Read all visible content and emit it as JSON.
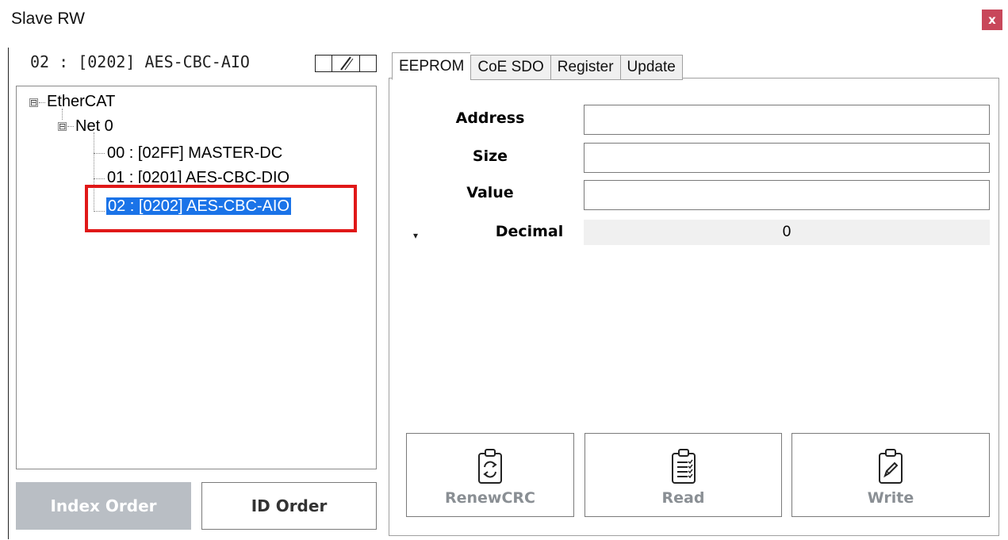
{
  "window": {
    "title": "Slave RW",
    "close_label": "x"
  },
  "left": {
    "slave_label": "02 : [0202] AES-CBC-AIO",
    "tree": {
      "root": "EtherCAT",
      "net": "Net 0",
      "items": [
        "00 : [02FF] MASTER-DC",
        "01 : [0201] AES-CBC-DIO",
        "02 : [0202] AES-CBC-AIO"
      ],
      "selected_index": 2,
      "root_expander": "⊟",
      "net_expander": "⊟"
    },
    "buttons": {
      "index_order": "Index Order",
      "id_order": "ID Order"
    }
  },
  "tabs": [
    "EEPROM",
    "CoE SDO",
    "Register",
    "Update"
  ],
  "active_tab": "EEPROM",
  "eeprom": {
    "address_label": "Address",
    "address_value": "",
    "size_label": "Size",
    "size_value": "",
    "value_label": "Value",
    "value_value": "",
    "format_label": "Decimal",
    "format_value": "0",
    "dropdown_glyph": "▾"
  },
  "actions": {
    "renew_crc": "RenewCRC",
    "read": "Read",
    "write": "Write"
  },
  "colors": {
    "close_bg": "#c8475a",
    "selection": "#1a73e8",
    "highlight": "#e01818",
    "disabled_button": "#b9bec4"
  }
}
